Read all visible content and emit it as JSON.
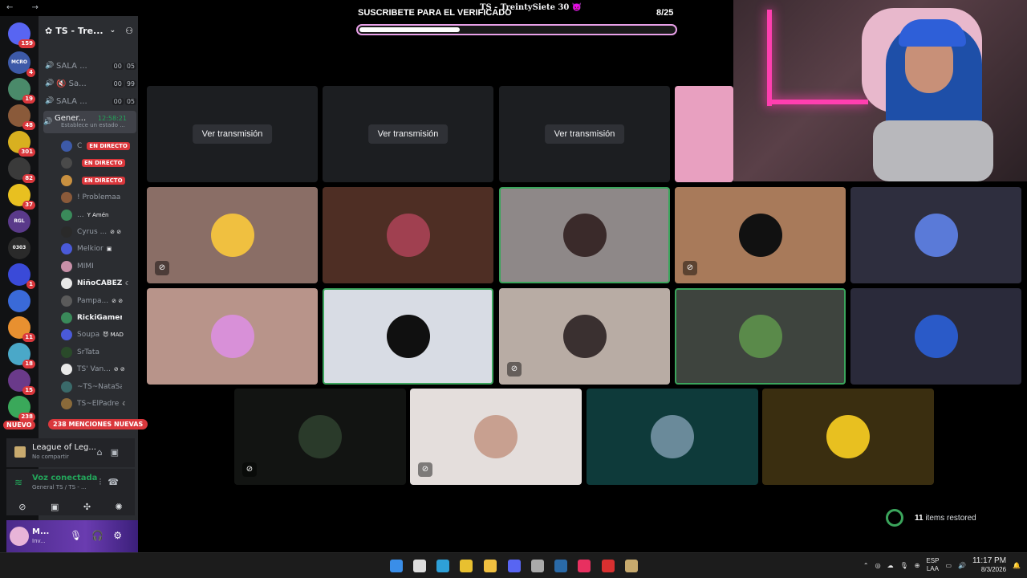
{
  "window": {
    "nav_arrows": "←  →",
    "stream_name": "TS - TreintySiete 30 👿"
  },
  "goal": {
    "title": "SUSCRIBETE PARA EL VERIFICADO",
    "current": 8,
    "target": 25,
    "count_label": "8/25",
    "progress_fraction": 0.32
  },
  "server_rail": {
    "home_badge": "159",
    "servers": [
      {
        "label": "MCRO",
        "badge": "4",
        "color": "#3d5aa8"
      },
      {
        "label": "",
        "badge": "19",
        "color": "#4a8a6a"
      },
      {
        "label": "",
        "badge": "48",
        "color": "#8a5a3a"
      },
      {
        "label": "",
        "badge": "301",
        "color": "#d8b020"
      },
      {
        "label": "",
        "badge": "82",
        "color": "#3a3a3a"
      },
      {
        "label": "",
        "badge": "37",
        "color": "#e8c020"
      },
      {
        "label": "RGL",
        "badge": "",
        "color": "#5a3a8a"
      },
      {
        "label": "0303",
        "badge": "",
        "color": "#2a2a2a"
      },
      {
        "label": "",
        "badge": "1",
        "color": "#3a4ad8"
      },
      {
        "label": "",
        "badge": "",
        "color": "#3a6ad8"
      },
      {
        "label": "",
        "badge": "11",
        "color": "#e89030"
      },
      {
        "label": "",
        "badge": "18",
        "color": "#4aa8c8"
      },
      {
        "label": "",
        "badge": "15",
        "color": "#6a3a8a"
      },
      {
        "label": "",
        "badge": "238",
        "color": "#3aa85a"
      }
    ],
    "nuevo_label": "NUEVO"
  },
  "sidebar": {
    "server_name": "TS - Tre...",
    "channels": [
      {
        "name": "SALA ...",
        "count_a": "00",
        "count_b": "05"
      },
      {
        "name": "🔇 Sa...",
        "count_a": "00",
        "count_b": "99"
      },
      {
        "name": "SALA ...",
        "count_a": "00",
        "count_b": "05"
      }
    ],
    "active_channel": {
      "name": "Gener...",
      "status_text": "Establece un estado ...",
      "timer": "12:58:21"
    },
    "voice_users": [
      {
        "name": "C",
        "live": "EN DIRECTO",
        "tag": "",
        "avatar_color": "#3d5aa8",
        "bold": false
      },
      {
        "name": "",
        "live": "EN DIRECTO",
        "tag": "",
        "avatar_color": "#4a4a4a",
        "bold": false
      },
      {
        "name": "",
        "live": "EN DIRECTO",
        "tag": "",
        "avatar_color": "#c89040",
        "bold": false
      },
      {
        "name": "! Problemaa",
        "live": "",
        "tag": "",
        "avatar_color": "#8a5a3a",
        "bold": false
      },
      {
        "name": "...",
        "live": "",
        "tag": "Y Amén",
        "avatar_color": "#3a8a5a",
        "bold": false
      },
      {
        "name": "Cyrus ...",
        "live": "",
        "tag": "⊘ ⊘",
        "avatar_color": "#2a2a2a",
        "bold": false
      },
      {
        "name": "Melkior",
        "live": "",
        "tag": "▣",
        "avatar_color": "#4a5ad8",
        "bold": false
      },
      {
        "name": "MIMI",
        "live": "",
        "tag": "",
        "avatar_color": "#c890a8",
        "bold": false
      },
      {
        "name": "NiñoCABEZA",
        "live": "",
        "tag": "☾",
        "avatar_color": "#e8e8e8",
        "bold": true
      },
      {
        "name": "Pampa...",
        "live": "",
        "tag": "⊘ ⊘",
        "avatar_color": "#5a5a5a",
        "bold": false
      },
      {
        "name": "RickiGamerR",
        "live": "",
        "tag": "",
        "avatar_color": "#3a8a5a",
        "bold": true
      },
      {
        "name": "Soupa",
        "live": "",
        "tag": "😈 MAD",
        "avatar_color": "#4a5ad8",
        "bold": false
      },
      {
        "name": "SrTata",
        "live": "",
        "tag": "",
        "avatar_color": "#2a4a2a",
        "bold": false
      },
      {
        "name": "TS' Van...",
        "live": "",
        "tag": "⊘ ⊘",
        "avatar_color": "#e8e8e8",
        "bold": false
      },
      {
        "name": "~TS~NataSald...",
        "live": "",
        "tag": "",
        "avatar_color": "#3a6a6a",
        "bold": false
      },
      {
        "name": "TS~ElPadre",
        "live": "",
        "tag": "☾",
        "avatar_color": "#8a6a3a",
        "bold": false
      }
    ],
    "mentions_label": "238 MENCIONES NUEVAS"
  },
  "activity": {
    "title": "League of Leg...",
    "subtitle": "No compartir"
  },
  "voice_panel": {
    "title": "Voz conectada",
    "subtitle": "General TS / TS - ..."
  },
  "user_panel": {
    "name": "M...",
    "status": "Inv..."
  },
  "stream_tiles": [
    {
      "button": "Ver transmisión"
    },
    {
      "button": "Ver transmisión"
    },
    {
      "button": "Ver transmisión"
    }
  ],
  "participant_tiles": [
    {
      "bg": "#8a6e66",
      "avatar": "#f0c040",
      "muted": true,
      "speaking": false
    },
    {
      "bg": "#4e2e24",
      "avatar": "#a04050",
      "muted": false,
      "speaking": false
    },
    {
      "bg": "#8e8888",
      "avatar": "#3a2a2a",
      "muted": false,
      "speaking": true
    },
    {
      "bg": "#a87a5a",
      "avatar": "#111111",
      "muted": true,
      "speaking": false
    },
    {
      "bg": "#2e2e3e",
      "avatar": "#5a7ad8",
      "muted": false,
      "speaking": false
    },
    {
      "bg": "#b8948a",
      "avatar": "#d890d8",
      "muted": false,
      "speaking": false
    },
    {
      "bg": "#d8dce4",
      "avatar": "#101010",
      "muted": false,
      "speaking": true
    },
    {
      "bg": "#b8aca4",
      "avatar": "#3a3030",
      "muted": true,
      "speaking": false
    },
    {
      "bg": "#3e443e",
      "avatar": "#5a8a4a",
      "muted": false,
      "speaking": true
    },
    {
      "bg": "#2a2a3a",
      "avatar": "#2a5ac8",
      "muted": false,
      "speaking": false
    },
    {
      "bg": "#121412",
      "avatar": "#2a3a2a",
      "muted": true,
      "speaking": false
    },
    {
      "bg": "#e4dedc",
      "avatar": "#c8a090",
      "muted": true,
      "speaking": false
    },
    {
      "bg": "#0e3a3a",
      "avatar": "#6a8a9a",
      "muted": false,
      "speaking": false
    },
    {
      "bg": "#3a2e10",
      "avatar": "#e8c020",
      "muted": false,
      "speaking": false
    }
  ],
  "notification": {
    "count": "11",
    "text": "items restored"
  },
  "taskbar": {
    "lang_top": "ESP",
    "lang_bottom": "LAA",
    "time": "11:17 PM",
    "date": "8/3/2026"
  },
  "colors": {
    "discord_red": "#da373c",
    "voice_green": "#23a55a",
    "progress_border": "#e8a0e8"
  }
}
